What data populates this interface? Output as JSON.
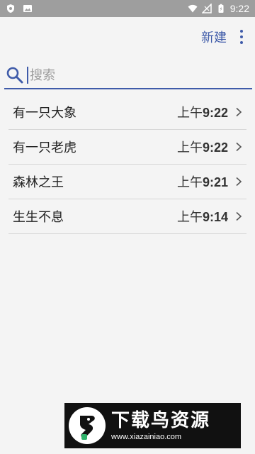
{
  "status_bar": {
    "time": "9:22",
    "left_icons": [
      "shield-icon",
      "image-icon"
    ],
    "right_icons": [
      "wifi-icon",
      "signal-icon",
      "battery-icon"
    ]
  },
  "toolbar": {
    "new_label": "新建",
    "more_icon": "more-vert-icon"
  },
  "search": {
    "placeholder": "搜索",
    "value": ""
  },
  "notes": [
    {
      "title": "有一只大象",
      "time_period": "上午",
      "time_value": "9:22"
    },
    {
      "title": "有一只老虎",
      "time_period": "上午",
      "time_value": "9:22"
    },
    {
      "title": "森林之王",
      "time_period": "上午",
      "time_value": "9:21"
    },
    {
      "title": "生生不息",
      "time_period": "上午",
      "time_value": "9:14"
    }
  ],
  "watermark": {
    "title": "下载鸟资源",
    "url": "www.xiazainiao.com"
  },
  "colors": {
    "accent": "#3f5ba9",
    "status_bar": "#9e9e9e",
    "background": "#f4f4f4",
    "divider": "#d6d6d6"
  }
}
